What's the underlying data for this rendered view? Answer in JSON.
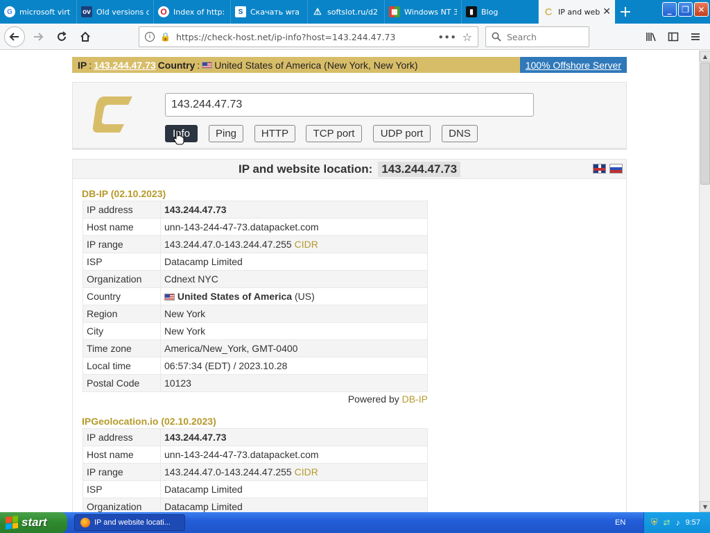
{
  "browser": {
    "tabs": [
      {
        "title": "microsoft virt",
        "icon": "google-icon",
        "active": false
      },
      {
        "title": "Old versions o",
        "icon": "oldversion-icon",
        "active": false
      },
      {
        "title": "Index of http:",
        "icon": "opera-icon",
        "active": false
      },
      {
        "title": "Скачать wra",
        "icon": "document-icon",
        "active": false
      },
      {
        "title": "softslot.ru/d2",
        "icon": "warning-icon",
        "active": false
      },
      {
        "title": "Windows NT 3",
        "icon": "windows-icon",
        "active": false
      },
      {
        "title": "Blog",
        "icon": "terminal-icon",
        "active": false
      },
      {
        "title": "IP and web",
        "icon": "checkhost-icon",
        "active": true
      }
    ],
    "url": "https://check-host.net/ip-info?host=143.244.47.73",
    "search_placeholder": "Search"
  },
  "topbar": {
    "ip_label": "IP",
    "ip_value": "143.244.47.73",
    "country_label": "Country",
    "country_value": "United States of America (New York, New York)",
    "offshore_link": "100% Offshore Server"
  },
  "checker": {
    "host_value": "143.244.47.73",
    "buttons": [
      "Info",
      "Ping",
      "HTTP",
      "TCP port",
      "UDP port",
      "DNS"
    ],
    "active_button": "Info"
  },
  "result": {
    "heading": "IP and website location:",
    "heading_ip": "143.244.47.73",
    "sources": [
      {
        "title": "DB-IP (02.10.2023)",
        "rows": [
          {
            "key": "IP address",
            "value": "143.244.47.73"
          },
          {
            "key": "Host name",
            "value": "unn-143-244-47-73.datapacket.com"
          },
          {
            "key": "IP range",
            "value": "143.244.47.0-143.244.47.255",
            "extra": "CIDR"
          },
          {
            "key": "ISP",
            "value": "Datacamp Limited"
          },
          {
            "key": "Organization",
            "value": "Cdnext NYC"
          },
          {
            "key": "Country",
            "value": "United States of America",
            "extra": "(US)"
          },
          {
            "key": "Region",
            "value": "New York"
          },
          {
            "key": "City",
            "value": "New York"
          },
          {
            "key": "Time zone",
            "value": "America/New_York, GMT-0400"
          },
          {
            "key": "Local time",
            "value": "06:57:34 (EDT) / 2023.10.28"
          },
          {
            "key": "Postal Code",
            "value": "10123"
          }
        ],
        "powered_by": "Powered by",
        "powered_source": "DB-IP"
      },
      {
        "title": "IPGeolocation.io (02.10.2023)",
        "rows": [
          {
            "key": "IP address",
            "value": "143.244.47.73"
          },
          {
            "key": "Host name",
            "value": "unn-143-244-47-73.datapacket.com"
          },
          {
            "key": "IP range",
            "value": "143.244.47.0-143.244.47.255",
            "extra": "CIDR"
          },
          {
            "key": "ISP",
            "value": "Datacamp Limited"
          },
          {
            "key": "Organization",
            "value": "Datacamp Limited"
          }
        ]
      }
    ]
  },
  "taskbar": {
    "start_label": "start",
    "task_title": "IP and website locati...",
    "language": "EN",
    "clock": "9:57"
  },
  "colors": {
    "accent_gold": "#b59a2c",
    "topbar_gold": "#d8bd69",
    "offshore_blue": "#2f78b9",
    "firefox_blue": "#0a84c8"
  }
}
